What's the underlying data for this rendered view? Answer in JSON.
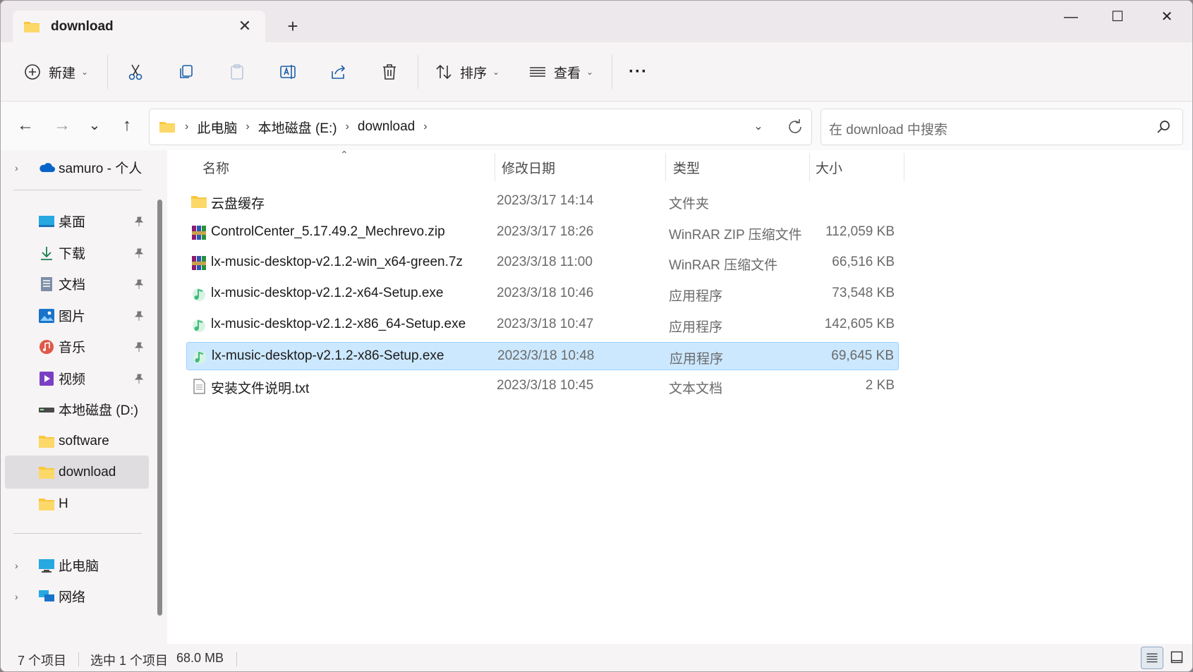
{
  "tab": {
    "title": "download",
    "close_label": "✕",
    "new_tab_label": "+"
  },
  "window_controls": {
    "minimize": "—",
    "maximize": "☐",
    "close": "✕"
  },
  "toolbar": {
    "new_label": "新建",
    "sort_label": "排序",
    "view_label": "查看",
    "more_label": "···"
  },
  "nav": {
    "back": "←",
    "forward": "→",
    "recent": "⌄",
    "up": "↑"
  },
  "address": {
    "crumbs": [
      "此电脑",
      "本地磁盘 (E:)",
      "download"
    ],
    "separator": "›"
  },
  "search": {
    "placeholder": "在 download 中搜索"
  },
  "sidebar": {
    "onedrive": {
      "label": "samuro - 个人"
    },
    "quick": [
      {
        "label": "桌面",
        "icon": "desktop-icon"
      },
      {
        "label": "下载",
        "icon": "download-icon"
      },
      {
        "label": "文档",
        "icon": "document-icon"
      },
      {
        "label": "图片",
        "icon": "picture-icon"
      },
      {
        "label": "音乐",
        "icon": "music-icon"
      },
      {
        "label": "视频",
        "icon": "video-icon"
      },
      {
        "label": "本地磁盘 (D:)",
        "icon": "drive-icon"
      },
      {
        "label": "software",
        "icon": "folder-icon"
      },
      {
        "label": "download",
        "icon": "folder-icon"
      },
      {
        "label": "H",
        "icon": "folder-icon"
      }
    ],
    "this_pc": {
      "label": "此电脑"
    },
    "network": {
      "label": "网络"
    }
  },
  "columns": {
    "name": "名称",
    "date": "修改日期",
    "type": "类型",
    "size": "大小"
  },
  "files": [
    {
      "name": "云盘缓存",
      "date": "2023/3/17 14:14",
      "type": "文件夹",
      "size": "",
      "icon": "folder-icon"
    },
    {
      "name": "ControlCenter_5.17.49.2_Mechrevo.zip",
      "date": "2023/3/17 18:26",
      "type": "WinRAR ZIP 压缩文件",
      "size": "112,059 KB",
      "icon": "winrar-icon"
    },
    {
      "name": "lx-music-desktop-v2.1.2-win_x64-green.7z",
      "date": "2023/3/18 11:00",
      "type": "WinRAR 压缩文件",
      "size": "66,516 KB",
      "icon": "winrar-icon"
    },
    {
      "name": "lx-music-desktop-v2.1.2-x64-Setup.exe",
      "date": "2023/3/18 10:46",
      "type": "应用程序",
      "size": "73,548 KB",
      "icon": "lx-music-icon"
    },
    {
      "name": "lx-music-desktop-v2.1.2-x86_64-Setup.exe",
      "date": "2023/3/18 10:47",
      "type": "应用程序",
      "size": "142,605 KB",
      "icon": "lx-music-icon"
    },
    {
      "name": "lx-music-desktop-v2.1.2-x86-Setup.exe",
      "date": "2023/3/18 10:48",
      "type": "应用程序",
      "size": "69,645 KB",
      "icon": "lx-music-icon",
      "selected": true
    },
    {
      "name": "安装文件说明.txt",
      "date": "2023/3/18 10:45",
      "type": "文本文档",
      "size": "2 KB",
      "icon": "text-file-icon"
    }
  ],
  "status": {
    "count": "7 个项目",
    "selection": "选中 1 个项目",
    "size": "68.0 MB"
  },
  "colors": {
    "accent": "#0067c0",
    "selection_bg": "#cce8ff",
    "folder": "#f8c73e"
  }
}
